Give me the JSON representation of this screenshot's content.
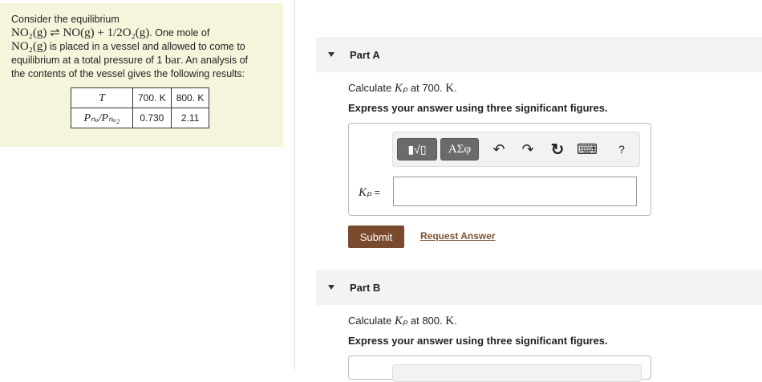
{
  "problem": {
    "intro": "Consider the equilibrium",
    "eq_left": "NO₂(g) ⇌ NO(g) + 1/2O₂(g)",
    "eq_tail": ". One mole of",
    "line3_species": "NO₂(g)",
    "line3_text": " is placed in a vessel and allowed to come to",
    "line4_pre": "equilibrium at a total pressure of 1 ",
    "line4_unit": "bar",
    "line4_post": ". An analysis of",
    "line5": "the contents of the vessel gives the following results:",
    "table": {
      "row1_label": "T",
      "row2_label": "Pₙₒ/Pₙₒ₂",
      "temps": [
        "700. K",
        "800. K"
      ],
      "ratios": [
        "0.730",
        "2.11"
      ]
    }
  },
  "partA": {
    "title": "Part A",
    "calc_pre": "Calculate ",
    "kp": "Kₚ",
    "calc_mid": " at 700. ",
    "calc_unit": "K",
    "calc_end": ".",
    "instruction": "Express your answer using three significant figures.",
    "toolbar": {
      "template_label": "▮√▯",
      "greek_label": "ΑΣφ",
      "undo": "↶",
      "redo": "↷",
      "reset": "↻",
      "keyboard": "⌨",
      "help": "?"
    },
    "answer_label": "Kₚ",
    "equals": " =",
    "answer_value": "",
    "submit_label": "Submit",
    "request_label": "Request Answer"
  },
  "partB": {
    "title": "Part B",
    "calc_pre": "Calculate ",
    "kp": "Kₚ",
    "calc_mid": " at 800. ",
    "calc_unit": "K",
    "calc_end": ".",
    "instruction": "Express your answer using three significant figures."
  }
}
